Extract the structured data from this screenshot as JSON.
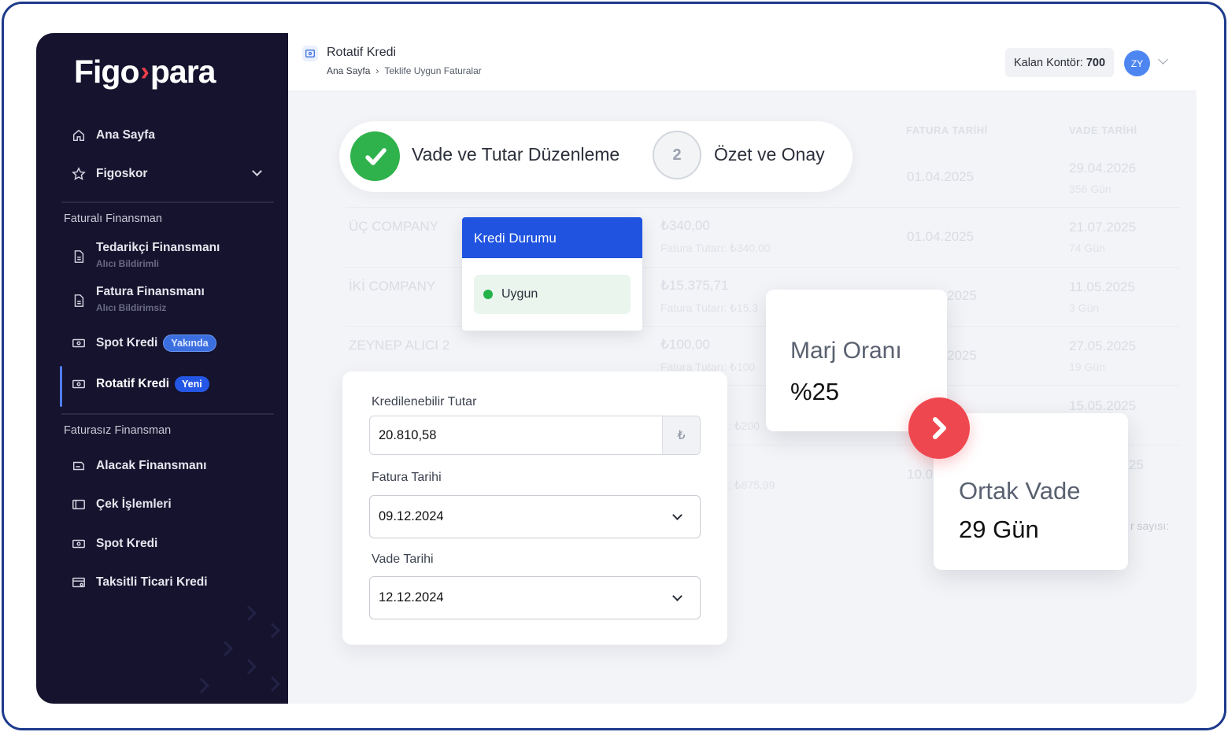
{
  "brand": {
    "part1": "Figo",
    "arrow": "›",
    "part2": "para",
    "accent_color": "#ef3e4a"
  },
  "sidebar": {
    "items_top": [
      {
        "label": "Ana Sayfa",
        "icon": "home-icon"
      },
      {
        "label": "Figoskor",
        "icon": "star-icon"
      }
    ],
    "section1": "Faturalı Finansman",
    "tedarikci": {
      "label": "Tedarikçi Finansmanı",
      "sub": "Alıcı Bildirimli"
    },
    "fatura": {
      "label": "Fatura Finansmanı",
      "sub": "Alıcı Bildirimsiz"
    },
    "spot1": {
      "label": "Spot Kredi",
      "badge": "Yakında"
    },
    "rotatif": {
      "label": "Rotatif Kredi",
      "badge": "Yeni"
    },
    "section2": "Faturasız Finansman",
    "items_bottom": [
      {
        "label": "Alacak Finansmanı"
      },
      {
        "label": "Çek İşlemleri"
      },
      {
        "label": "Spot Kredi"
      },
      {
        "label": "Taksitli Ticari Kredi"
      }
    ]
  },
  "header": {
    "title": "Rotatif Kredi",
    "breadcrumb": [
      "Ana Sayfa",
      "Teklife Uygun Faturalar"
    ],
    "credit_label": "Kalan Kontör:",
    "credit_value": "700",
    "avatar_initials": "ZY"
  },
  "background_table": {
    "headers": [
      "FATURA TARİHİ",
      "VADE TARİHİ"
    ],
    "companies": [
      "ÜÇ COMPANY",
      "İKİ COMPANY",
      "ZEYNEP ALICI 2"
    ],
    "amounts": [
      "₺340,00",
      "₺15.375,71",
      "₺100,00"
    ],
    "amount_notes": [
      "Fatura Tutarı: ₺340,00",
      "Fatura Tutarı: ₺15.3",
      "Fatura Tutarı: ₺100",
      ": ₺200",
      ": ₺875,99"
    ],
    "fatura_dates": [
      "01.04.2025",
      "01.04.2025",
      "2025",
      "2025",
      "10.0"
    ],
    "vade_dates": [
      "29.04.2026",
      "21.07.2025",
      "11.05.2025",
      "27.05.2025",
      "15.05.2025",
      "25"
    ],
    "vade_days": [
      "356 Gün",
      "74 Gün",
      "3 Gün",
      "19 Gün"
    ],
    "footer_fragment": "r sayısı:"
  },
  "stepper": {
    "step1_label": "Vade ve Tutar Düzenleme",
    "step2_number": "2",
    "step2_label": "Özet ve Onay"
  },
  "kredi_durumu": {
    "title": "Kredi Durumu",
    "status": "Uygun"
  },
  "form": {
    "amount_label": "Kredilenebilir Tutar",
    "amount_value": "20.810,58",
    "currency": "₺",
    "invoice_date_label": "Fatura Tarihi",
    "invoice_date_value": "09.12.2024",
    "due_date_label": "Vade Tarihi",
    "due_date_value": "12.12.2024"
  },
  "marj": {
    "title": "Marj Oranı",
    "value": "%25"
  },
  "ortak_vade": {
    "title": "Ortak Vade",
    "value": "29 Gün"
  }
}
